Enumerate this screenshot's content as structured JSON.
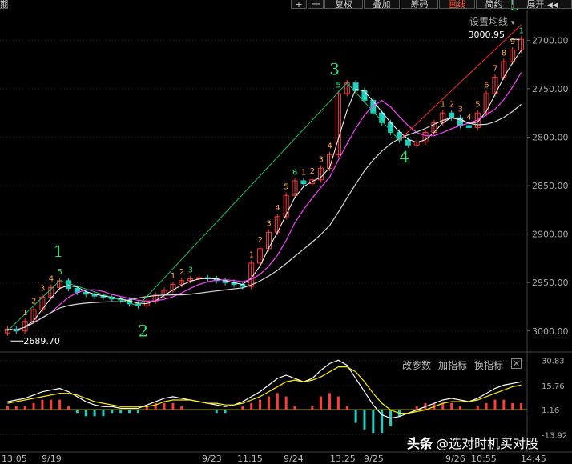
{
  "toolbar": {
    "left_fragment": "期",
    "plus": "+",
    "minus": "一",
    "buttons": [
      "复权",
      "叠加",
      "筹码",
      "画线",
      "简约",
      "展开"
    ],
    "active_button": "画线",
    "expand_arrows": "◀◀"
  },
  "main_panel": {
    "settings_label": "设置均线",
    "settings_caret": "▾",
    "y_ticks": [
      "3000.00",
      "2950.00",
      "2900.00",
      "2850.00",
      "2800.00",
      "2750.00",
      "2700.00"
    ],
    "annotations": {
      "low_value": "2689.70",
      "high_value": "3000.95",
      "wave_labels": [
        "1",
        "2",
        "3",
        "4",
        "5"
      ]
    }
  },
  "indicator_panel": {
    "links": [
      "改参数",
      "加指标",
      "换指标"
    ],
    "close_symbol": "✕",
    "y_ticks": [
      "30.83",
      "15.76",
      "1.16",
      "-13.92"
    ]
  },
  "x_axis": {
    "labels": [
      "13:05",
      "9/19",
      "9/23",
      "11:15",
      "9/24",
      "13:25",
      "9/25",
      "9/26",
      "10:55",
      "14:45"
    ]
  },
  "watermark": {
    "logo": "头条",
    "text": "@选对时机买对股"
  },
  "colors": {
    "background": "#000000",
    "up_candle": "#ff3b3b",
    "down_candle": "#1fd0c0",
    "ma_fast": "#ffffff",
    "ma_mid": "#ff40ff",
    "ma_slow": "#d8d8d8",
    "wave_line_up": "#17c067",
    "wave_line_down": "#ff2a2a",
    "wave_label": "#33dd77",
    "td_count": "#ffa733",
    "td_count_alt": "#2ee07a",
    "dif_line": "#ffffff",
    "dea_line": "#ffee00",
    "hist_up": "#ff3b3b",
    "hist_down": "#1fd0c0",
    "zero_line": "#d9d900"
  },
  "chart_data": [
    {
      "type": "candlestick",
      "title": "",
      "ylim": [
        2680,
        3030
      ],
      "y_ticks": [
        2700,
        2750,
        2800,
        2850,
        2900,
        2950,
        3000
      ],
      "grid": true,
      "x_tick_labels": [
        "13:05",
        "9/19",
        "9/23",
        "11:15",
        "9/24",
        "13:25",
        "9/25",
        "9/26",
        "10:55",
        "14:45"
      ],
      "annotations": [
        {
          "text": "2689.70",
          "value": 2689.7
        },
        {
          "text": "3000.95",
          "value": 3000.95
        }
      ],
      "wave_points": [
        {
          "label": "1",
          "value": 2752
        },
        {
          "label": "2",
          "value": 2726
        },
        {
          "label": "3",
          "value": 2956
        },
        {
          "label": "4",
          "value": 2897
        },
        {
          "label": "5",
          "value": 3016
        }
      ],
      "close_path": [
        2702,
        2700,
        2710,
        2722,
        2735,
        2745,
        2752,
        2744,
        2740,
        2738,
        2736,
        2735,
        2733,
        2732,
        2728,
        2726,
        2731,
        2737,
        2742,
        2748,
        2752,
        2754,
        2755,
        2754,
        2752,
        2750,
        2748,
        2746,
        2770,
        2785,
        2802,
        2818,
        2840,
        2855,
        2852,
        2856,
        2868,
        2882,
        2945,
        2956,
        2948,
        2938,
        2925,
        2915,
        2905,
        2897,
        2892,
        2895,
        2905,
        2915,
        2925,
        2920,
        2912,
        2910,
        2925,
        2945,
        2962,
        2978,
        2990,
        3001
      ]
    },
    {
      "type": "macd",
      "title": "",
      "ylim": [
        -22,
        36
      ],
      "y_ticks": [
        30.83,
        15.76,
        1.16,
        -13.92
      ],
      "series": [
        {
          "name": "",
          "kind": "line",
          "role": "dif",
          "values": [
            6,
            7,
            8,
            10,
            12,
            13,
            14,
            12,
            9,
            6,
            4,
            3,
            3,
            2,
            2,
            2,
            4,
            6,
            8,
            9,
            8,
            7,
            6,
            5,
            4,
            3,
            4,
            6,
            9,
            12,
            16,
            20,
            22,
            20,
            18,
            20,
            25,
            29,
            31,
            28,
            20,
            12,
            4,
            -2,
            -4,
            -3,
            -1,
            1,
            3,
            5,
            7,
            8,
            7,
            6,
            8,
            11,
            14,
            16,
            17,
            18
          ]
        },
        {
          "name": "",
          "kind": "line",
          "role": "dea",
          "values": [
            5,
            6,
            7,
            8,
            9,
            10,
            11,
            11,
            10,
            8,
            6,
            5,
            4,
            3,
            3,
            3,
            3,
            4,
            6,
            7,
            7,
            7,
            6,
            5,
            5,
            4,
            4,
            5,
            7,
            9,
            12,
            15,
            18,
            19,
            18,
            19,
            21,
            24,
            27,
            27,
            24,
            18,
            11,
            5,
            1,
            -1,
            -1,
            0,
            1,
            3,
            5,
            6,
            6,
            6,
            7,
            9,
            11,
            13,
            15,
            16
          ]
        },
        {
          "name": "",
          "kind": "bar",
          "role": "hist",
          "values": [
            2,
            2,
            2,
            4,
            6,
            6,
            6,
            2,
            -2,
            -4,
            -4,
            -4,
            -2,
            -2,
            -2,
            -2,
            2,
            4,
            4,
            4,
            2,
            0,
            0,
            0,
            -2,
            -2,
            0,
            2,
            4,
            6,
            8,
            10,
            8,
            2,
            0,
            2,
            8,
            10,
            8,
            2,
            -8,
            -12,
            -14,
            -14,
            -10,
            -4,
            0,
            2,
            4,
            4,
            4,
            4,
            2,
            0,
            2,
            4,
            6,
            6,
            4,
            4
          ]
        }
      ]
    }
  ]
}
